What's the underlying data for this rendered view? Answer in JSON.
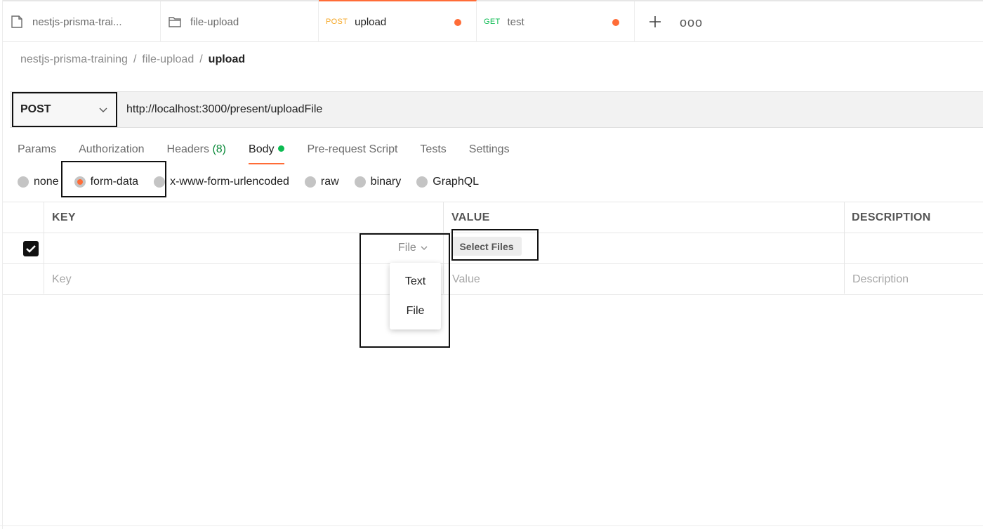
{
  "tabs": [
    {
      "label": "nestjs-prisma-trai...",
      "icon": "collection-icon"
    },
    {
      "label": "file-upload",
      "icon": "folder-icon"
    },
    {
      "method": "POST",
      "label": "upload",
      "method_color": "#f5a623"
    },
    {
      "method": "GET",
      "label": "test",
      "method_color": "#0cbb52"
    }
  ],
  "tab_more": "ooo",
  "breadcrumb": {
    "items": [
      "nestjs-prisma-training",
      "file-upload"
    ],
    "current": "upload",
    "separator": "/"
  },
  "request": {
    "method": "POST",
    "url": "http://localhost:3000/present/uploadFile"
  },
  "request_tabs": {
    "params": "Params",
    "authorization": "Authorization",
    "headers": "Headers",
    "headers_count": "(8)",
    "body": "Body",
    "prerequest": "Pre-request Script",
    "tests": "Tests",
    "settings": "Settings"
  },
  "body_types": {
    "none": "none",
    "form_data": "form-data",
    "urlencoded": "x-www-form-urlencoded",
    "raw": "raw",
    "binary": "binary",
    "graphql": "GraphQL"
  },
  "table": {
    "headers": {
      "key": "KEY",
      "value": "VALUE",
      "description": "DESCRIPTION"
    },
    "row1": {
      "type": "File",
      "value_button": "Select Files"
    },
    "placeholders": {
      "key": "Key",
      "value": "Value",
      "description": "Description"
    }
  },
  "type_dropdown": {
    "options": [
      "Text",
      "File"
    ]
  },
  "colors": {
    "accent": "#ff6c37",
    "active_dot": "#0cbb52"
  }
}
